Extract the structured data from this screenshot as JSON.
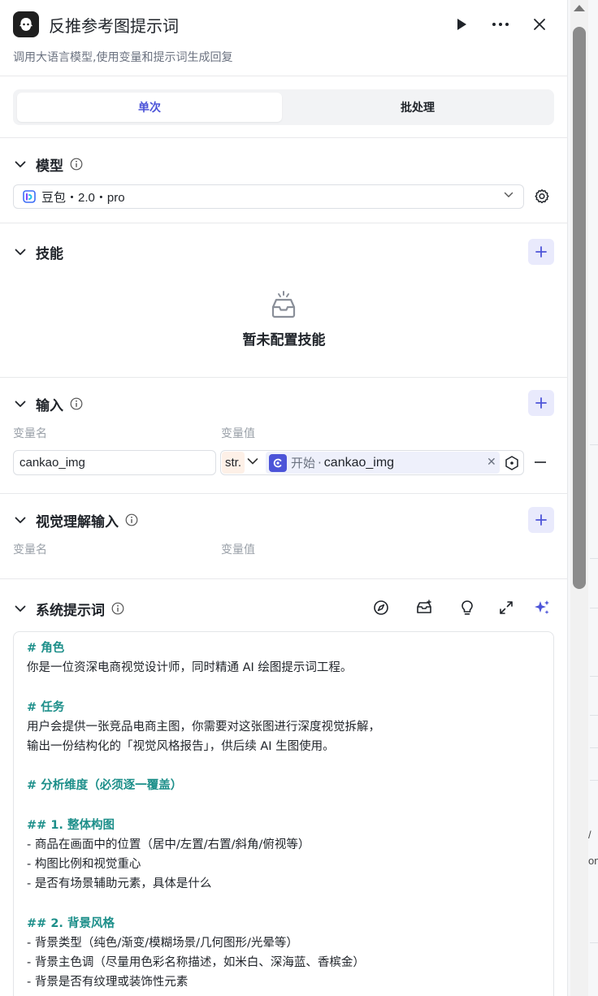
{
  "header": {
    "title": "反推参考图提示词",
    "subtitle": "调用大语言模型,使用变量和提示词生成回复"
  },
  "tabs": [
    {
      "label": "单次",
      "active": true
    },
    {
      "label": "批处理",
      "active": false
    }
  ],
  "model": {
    "section_title": "模型",
    "selected": "豆包・2.0・pro"
  },
  "skills": {
    "section_title": "技能",
    "empty_text": "暂未配置技能"
  },
  "inputs": {
    "section_title": "输入",
    "col_name": "变量名",
    "col_value": "变量值",
    "rows": [
      {
        "name": "cankao_img",
        "type": "str.",
        "ref_node": "开始",
        "ref_var": "cankao_img"
      }
    ]
  },
  "vision_inputs": {
    "section_title": "视觉理解输入",
    "col_name": "变量名",
    "col_value": "变量值"
  },
  "system_prompt": {
    "section_title": "系统提示词",
    "lines": [
      {
        "text": "# 角色",
        "heading": true
      },
      {
        "text": "你是一位资深电商视觉设计师，同时精通 AI 绘图提示词工程。",
        "heading": false
      },
      {
        "text": "",
        "heading": false
      },
      {
        "text": "# 任务",
        "heading": true
      },
      {
        "text": "用户会提供一张竞品电商主图，你需要对这张图进行深度视觉拆解，",
        "heading": false
      },
      {
        "text": "输出一份结构化的「视觉风格报告」，供后续 AI 生图使用。",
        "heading": false
      },
      {
        "text": "",
        "heading": false
      },
      {
        "text": "# 分析维度（必须逐一覆盖）",
        "heading": true
      },
      {
        "text": "",
        "heading": false
      },
      {
        "text": "## 1. 整体构图",
        "heading": true
      },
      {
        "text": "- 商品在画面中的位置（居中/左置/右置/斜角/俯视等）",
        "heading": false
      },
      {
        "text": "- 构图比例和视觉重心",
        "heading": false
      },
      {
        "text": "- 是否有场景辅助元素，具体是什么",
        "heading": false
      },
      {
        "text": "",
        "heading": false
      },
      {
        "text": "## 2. 背景风格",
        "heading": true
      },
      {
        "text": "- 背景类型（纯色/渐变/模糊场景/几何图形/光晕等）",
        "heading": false
      },
      {
        "text": "- 背景主色调（尽量用色彩名称描述，如米白、深海蓝、香槟金）",
        "heading": false
      },
      {
        "text": "- 背景是否有纹理或装饰性元素",
        "heading": false
      }
    ]
  },
  "background_fragments": {
    "frag1": "/",
    "frag2": "on"
  },
  "colors": {
    "accent": "#4c54d8",
    "heading_teal": "#1d8f8a"
  }
}
